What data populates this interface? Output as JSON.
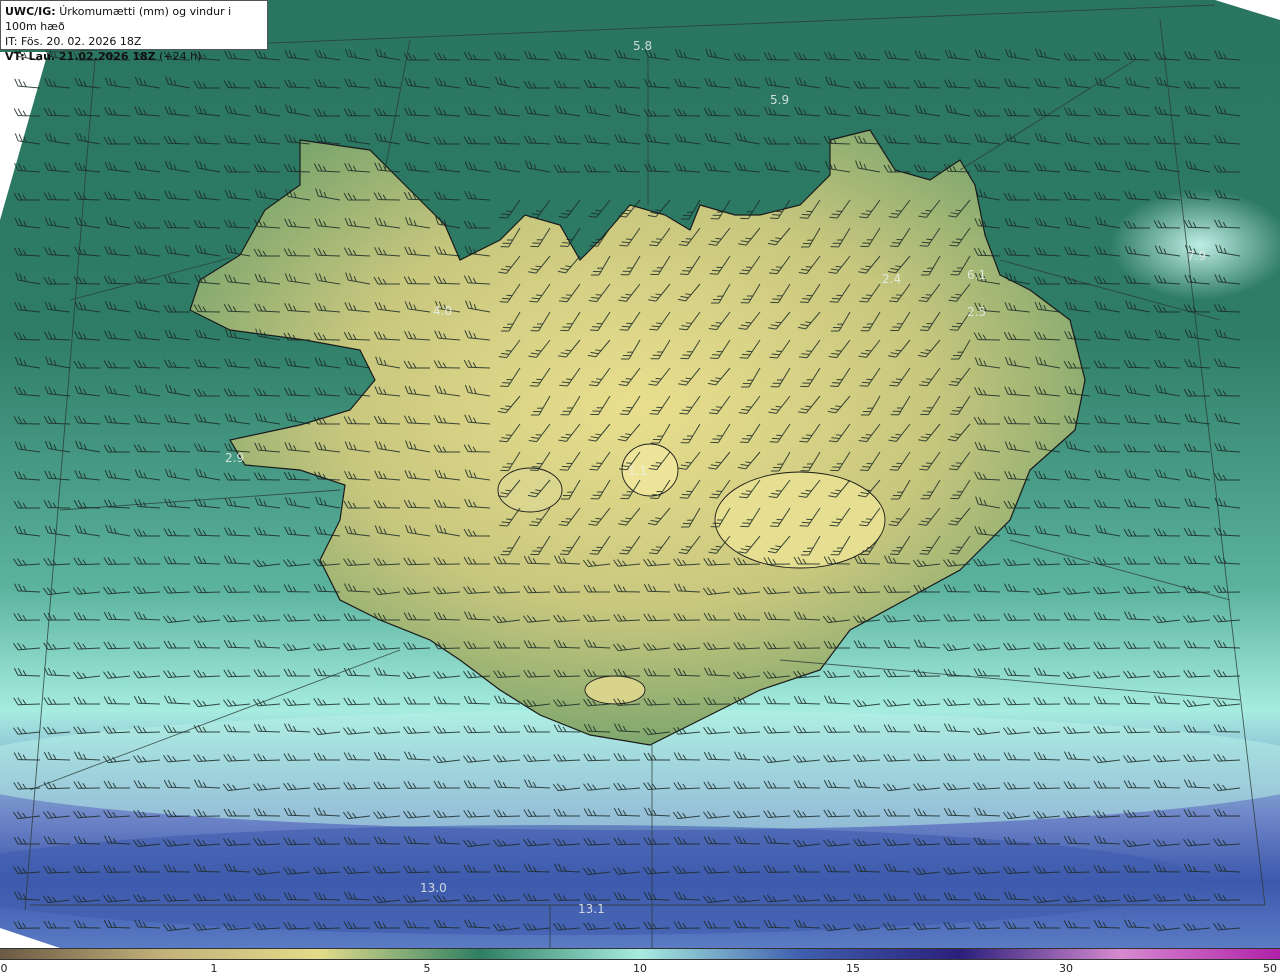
{
  "header": {
    "model": "UWC/IG:",
    "title": "Úrkomumætti (mm) og vindur i 100m hæð",
    "it_line": "IT: Fös. 20. 02. 2026 18Z",
    "vt_bold": "VT: Lau. 21.02.2026 18Z",
    "vt_suffix": "(+24 h)"
  },
  "value_labels": [
    {
      "text": "5.8"
    },
    {
      "text": "5.9"
    },
    {
      "text": "7.9"
    },
    {
      "text": "6.1"
    },
    {
      "text": "2.4"
    },
    {
      "text": "2.5"
    },
    {
      "text": "4.0"
    },
    {
      "text": "2.9"
    },
    {
      "text": "1.1"
    },
    {
      "text": "13.0"
    },
    {
      "text": "13.1"
    }
  ],
  "colorbar": {
    "ticks": [
      {
        "label": "0",
        "value": 0
      },
      {
        "label": "1",
        "value": 1
      },
      {
        "label": "5",
        "value": 5
      },
      {
        "label": "10",
        "value": 10
      },
      {
        "label": "15",
        "value": 15
      },
      {
        "label": "30",
        "value": 30
      },
      {
        "label": "50",
        "value": 50
      }
    ],
    "colors": [
      "#6b5a44",
      "#c2b07a",
      "#e2dc8a",
      "#2e7f63",
      "#a8ecdf",
      "#3f5fae",
      "#2a1f7a",
      "#d68ad0",
      "#b020a8"
    ]
  },
  "colors": {
    "ocean_dark": "#2f7a66",
    "ocean_light": "#9fe6d9",
    "land_low": "#7fa56a",
    "land_high": "#e8de8c",
    "south_blue": "#4561b3"
  }
}
